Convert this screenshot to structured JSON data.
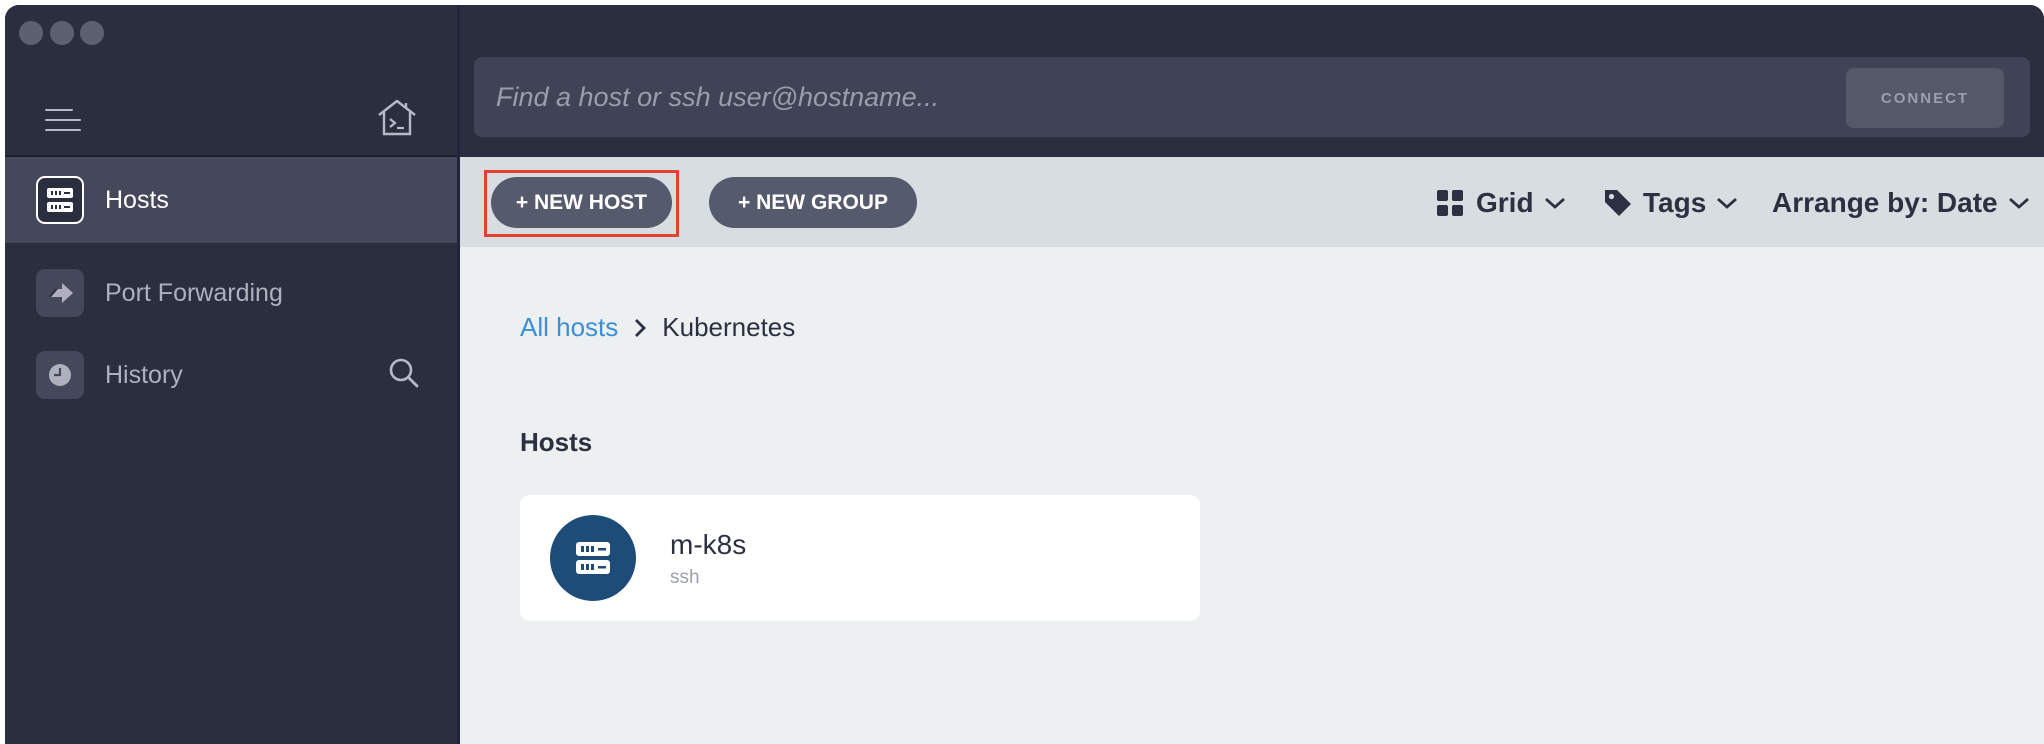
{
  "window": {
    "traffic_lights": [
      "close",
      "minimize",
      "maximize"
    ]
  },
  "sidebar": {
    "menu_icon": "hamburger-menu-icon",
    "home_icon": "terminal-home-icon",
    "items": [
      {
        "label": "Hosts",
        "icon": "server-icon",
        "active": true
      },
      {
        "label": "Port Forwarding",
        "icon": "forward-arrow-icon",
        "active": false
      },
      {
        "label": "History",
        "icon": "clock-icon",
        "active": false
      }
    ],
    "search_icon": "magnifier-icon"
  },
  "topbar": {
    "search_placeholder": "Find a host or ssh user@hostname...",
    "search_value": "",
    "connect_label": "CONNECT"
  },
  "toolbar": {
    "new_host_label": "+ NEW HOST",
    "new_group_label": "+ NEW GROUP",
    "view_label": "Grid",
    "tags_label": "Tags",
    "arrange_label": "Arrange by: Date"
  },
  "content": {
    "breadcrumb": {
      "root": "All hosts",
      "current": "Kubernetes"
    },
    "section_title": "Hosts",
    "hosts": [
      {
        "name": "m-k8s",
        "protocol": "ssh"
      }
    ]
  },
  "colors": {
    "accent_link": "#3b8fd4",
    "highlight_border": "#e5412e",
    "host_avatar": "#1d4c78",
    "sidebar_bg": "#2b2e3f"
  }
}
